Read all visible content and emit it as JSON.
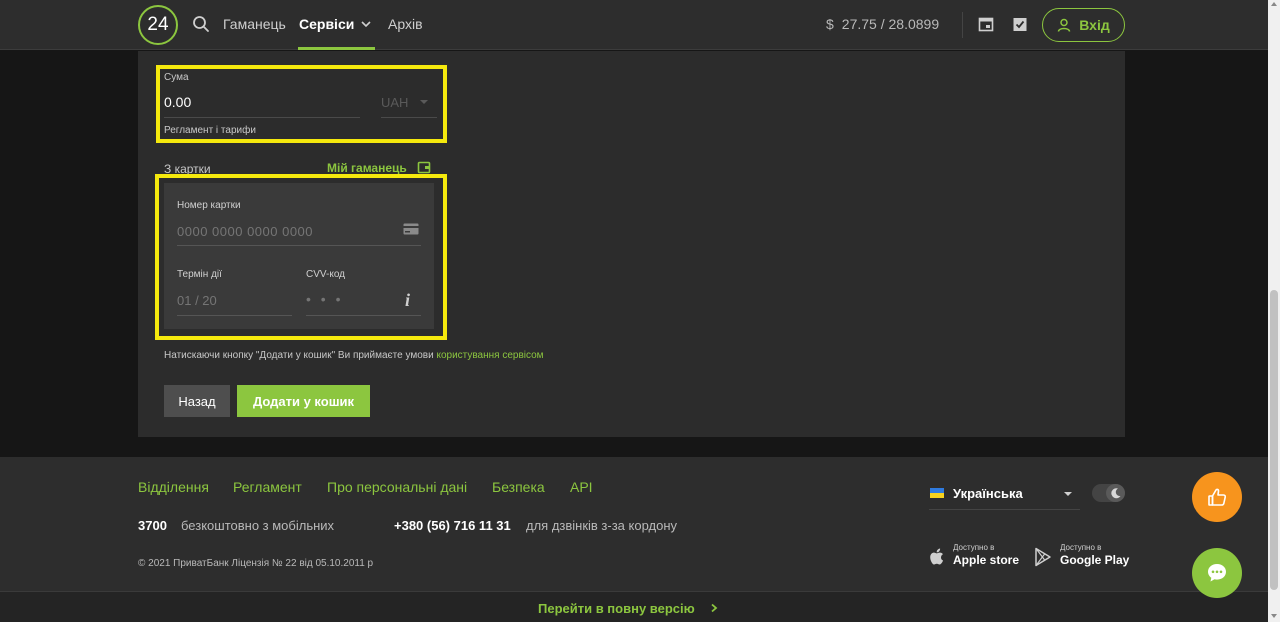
{
  "header": {
    "logo": "24",
    "nav": {
      "wallet": "Гаманець",
      "services": "Сервіси",
      "archive": "Архів"
    },
    "rate": {
      "currency": "$",
      "value": "27.75 / 28.0899"
    },
    "login_label": "Вхід"
  },
  "form": {
    "sum_label": "Сума",
    "sum_value": "0.00",
    "currency": "UAH",
    "regulations_link": "Регламент і тарифи",
    "from_card_label": "З картки",
    "my_wallet_link": "Мій гаманець",
    "card_number_label": "Номер картки",
    "card_number_placeholder": "0000 0000 0000 0000",
    "expiry_label": "Термін дії",
    "expiry_placeholder": "01 / 20",
    "cvv_label": "CVV-код",
    "cvv_placeholder": "• • •",
    "info_glyph": "i",
    "terms_prefix": "Натискаючи кнопку \"Додати у кошик\" Ви приймаєте умови ",
    "terms_link": "користування сервісом",
    "back_button": "Назад",
    "add_to_cart_button": "Додати у кошик"
  },
  "footer": {
    "links": [
      "Відділення",
      "Регламент",
      "Про персональні дані",
      "Безпека",
      "API"
    ],
    "phone_short": "3700",
    "phone_short_note": "безкоштовно з мобільних",
    "phone_full": "+380 (56) 716 11 31",
    "phone_full_note": "для дзвінків з-за кордону",
    "copyright": "© 2021 ПриватБанк Ліцензія № 22 від 05.10.2011 р",
    "language": "Українська",
    "apple_small": "Доступно в",
    "apple_big": "Apple store",
    "google_small": "Доступно в",
    "google_big": "Google Play",
    "full_version_link": "Перейти в повну версію"
  },
  "colors": {
    "accent_green": "#8cc63f",
    "highlight_yellow": "#f5e90d",
    "fab_orange": "#f7941d"
  },
  "icons": [
    "search-icon",
    "chevron-down-icon",
    "calendar-icon",
    "checklist-icon",
    "user-icon",
    "wallet-icon",
    "credit-card-icon",
    "info-icon",
    "flag-icon",
    "moon-icon",
    "apple-icon",
    "google-play-icon",
    "chevron-right-icon",
    "thumbs-up-icon",
    "chat-icon"
  ]
}
